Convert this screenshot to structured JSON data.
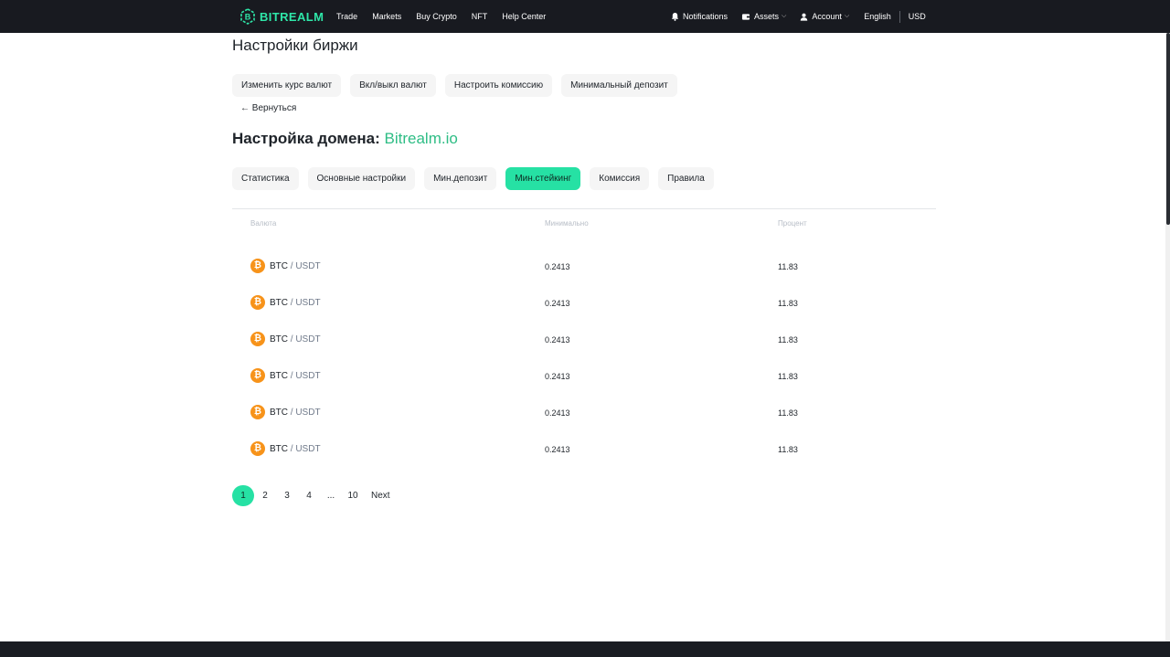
{
  "header": {
    "logo_text": "BITREALM",
    "nav": [
      "Trade",
      "Markets",
      "Buy Crypto",
      "NFT",
      "Help Center"
    ],
    "notifications_label": "Notifications",
    "assets_label": "Assets",
    "account_label": "Account",
    "language": "English",
    "currency": "USD"
  },
  "page": {
    "title": "Настройки биржи",
    "actions": [
      "Изменить курс валют",
      "Вкл/выкл валют",
      "Настроить комиссию",
      "Минимальный депозит"
    ],
    "back_label": "← Вернуться",
    "domain_prefix": "Настройка домена: ",
    "domain_name": "Bitrealm.io",
    "tabs": [
      "Статистика",
      "Основные настройки",
      "Мин.депозит",
      "Мин.стейкинг",
      "Комиссия",
      "Правила"
    ],
    "active_tab": "Мин.стейкинг"
  },
  "table": {
    "columns": [
      "Валюта",
      "Минимально",
      "Процент"
    ],
    "rows": [
      {
        "base": "BTC",
        "quote": " / USDT",
        "min": "0.2413",
        "percent": "11.83"
      },
      {
        "base": "BTC",
        "quote": " / USDT",
        "min": "0.2413",
        "percent": "11.83"
      },
      {
        "base": "BTC",
        "quote": " / USDT",
        "min": "0.2413",
        "percent": "11.83"
      },
      {
        "base": "BTC",
        "quote": " / USDT",
        "min": "0.2413",
        "percent": "11.83"
      },
      {
        "base": "BTC",
        "quote": " / USDT",
        "min": "0.2413",
        "percent": "11.83"
      },
      {
        "base": "BTC",
        "quote": " / USDT",
        "min": "0.2413",
        "percent": "11.83"
      }
    ]
  },
  "pagination": {
    "pages": [
      "1",
      "2",
      "3",
      "4",
      "...",
      "10"
    ],
    "active_page": "1",
    "next_label": "Next"
  },
  "colors": {
    "accent": "#26e1a4",
    "domain_text": "#2ebd85",
    "topbar": "#181a20",
    "bitcoin": "#f7931a"
  },
  "icons": {
    "logo": "bitrealm-logo-icon",
    "notifications": "bell-icon",
    "assets": "wallet-icon",
    "account": "user-icon",
    "coin": "bitcoin-icon",
    "dropdown": "chevron-down-icon"
  }
}
